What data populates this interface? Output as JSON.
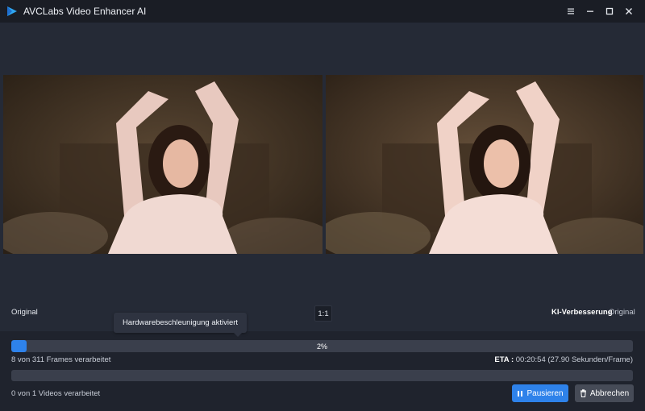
{
  "app": {
    "title": "AVCLabs Video Enhancer AI",
    "logo_icon": "play-triangle-logo",
    "accent_color": "#2e82ea"
  },
  "window_controls": [
    "menu-icon",
    "minimize-icon",
    "maximize-icon",
    "close-icon"
  ],
  "preview": {
    "left_label": "Original",
    "ratio_button": "1:1",
    "right_label_active": "KI-Verbesserung",
    "right_label_alt": "Original"
  },
  "tooltip": {
    "text": "Hardwarebeschleunigung aktiviert"
  },
  "progress": {
    "percent_label": "2%",
    "fraction": 0.025,
    "frames_text": "8 von 311 Frames verarbeitet",
    "eta_label": "ETA :",
    "eta_value": "00:20:54 (27.90 Sekunden/Frame)"
  },
  "overall": {
    "videos_text": "0 von 1 Videos verarbeitet",
    "fraction": 0
  },
  "actions": {
    "pause_label": "Pausieren",
    "pause_icon": "pause-icon",
    "cancel_label": "Abbrechen",
    "cancel_icon": "trash-icon"
  }
}
